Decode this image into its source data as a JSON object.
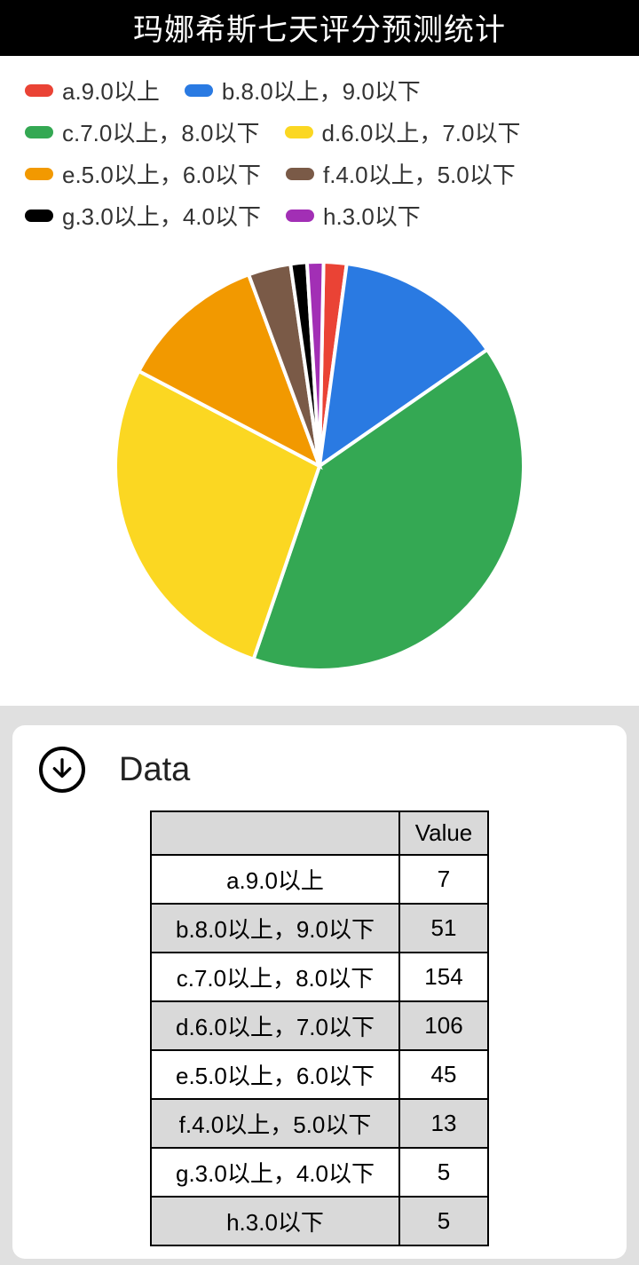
{
  "title": "玛娜希斯七天评分预测统计",
  "data_section_title": "Data",
  "table_value_header": "Value",
  "chart_data": {
    "type": "pie",
    "title": "玛娜希斯七天评分预测统计",
    "series": [
      {
        "name": "a.9.0以上",
        "value": 7,
        "color": "#ea4335"
      },
      {
        "name": "b.8.0以上，9.0以下",
        "value": 51,
        "color": "#2a7ae2"
      },
      {
        "name": "c.7.0以上，8.0以下",
        "value": 154,
        "color": "#34a853"
      },
      {
        "name": "d.6.0以上，7.0以下",
        "value": 106,
        "color": "#fbd722"
      },
      {
        "name": "e.5.0以上，6.0以下",
        "value": 45,
        "color": "#f29900"
      },
      {
        "name": "f.4.0以上，5.0以下",
        "value": 13,
        "color": "#7a5a47"
      },
      {
        "name": "g.3.0以上，4.0以下",
        "value": 5,
        "color": "#000000"
      },
      {
        "name": "h.3.0以下",
        "value": 5,
        "color": "#a22fb5"
      }
    ]
  }
}
